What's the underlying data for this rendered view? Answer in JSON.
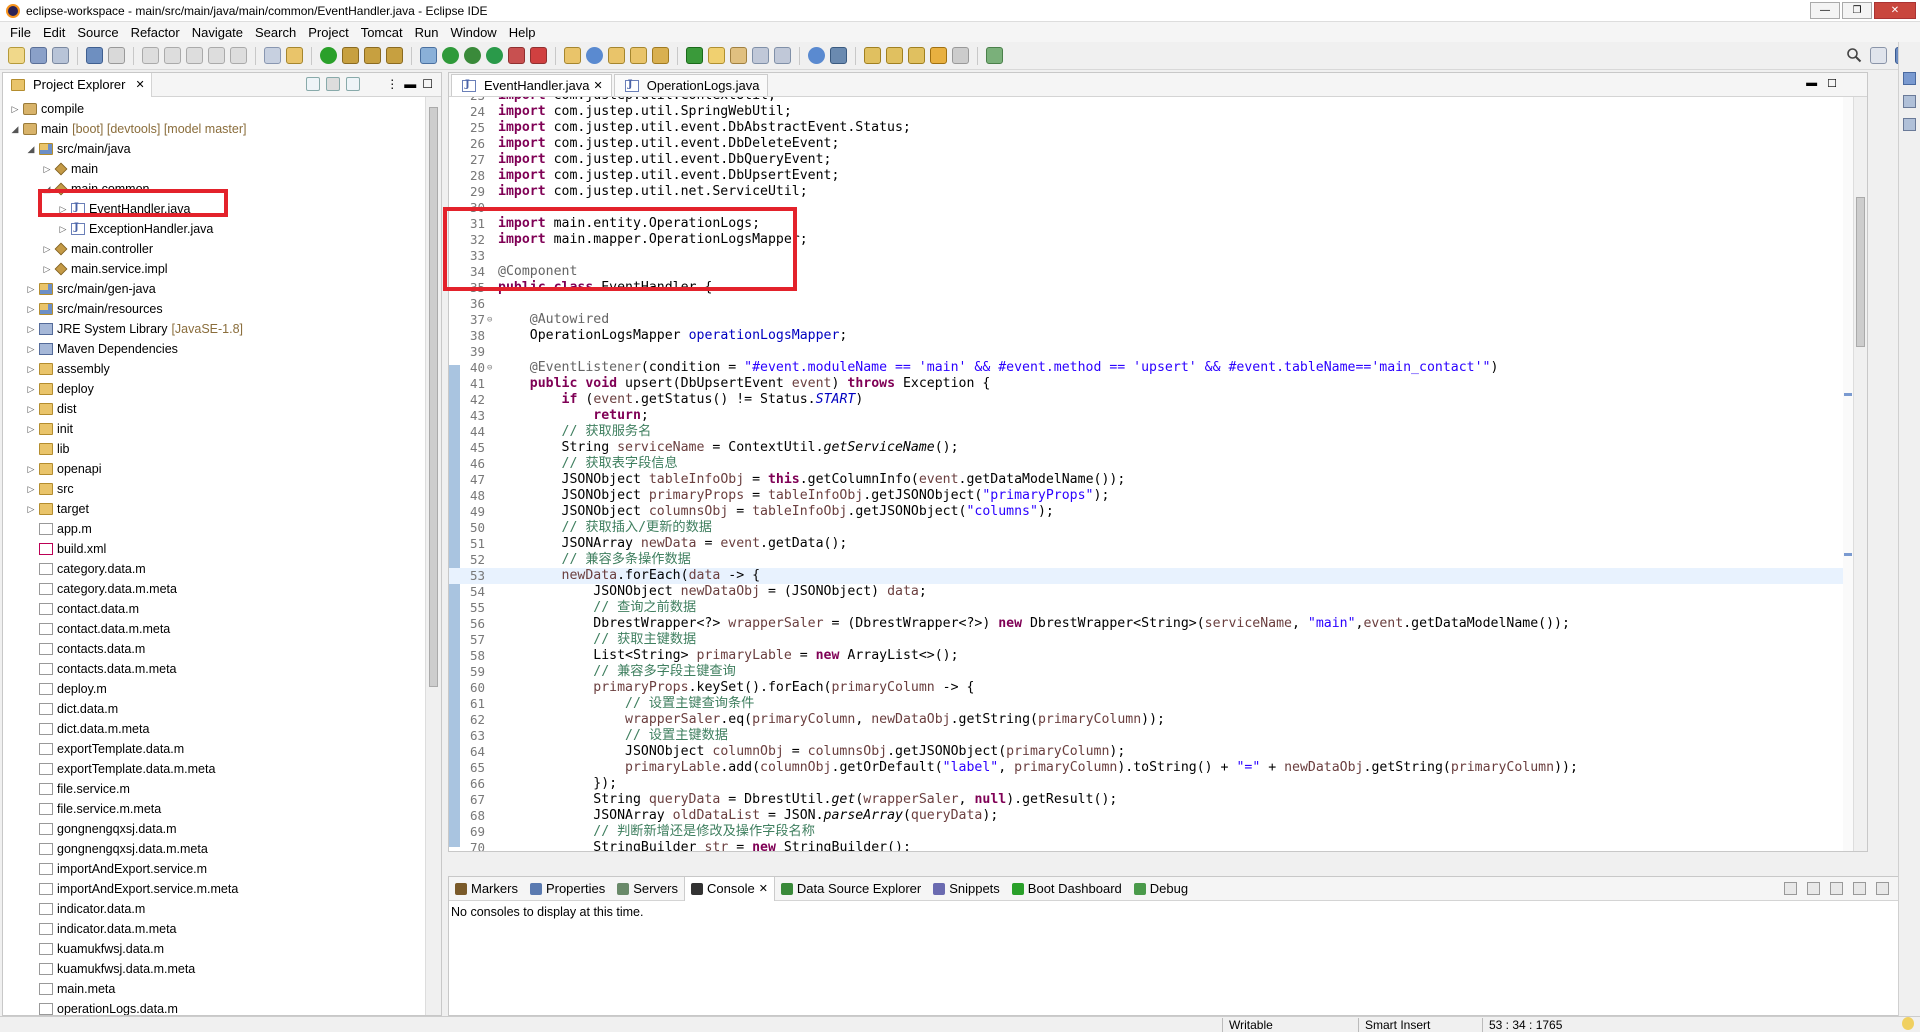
{
  "window": {
    "title": "eclipse-workspace - main/src/main/java/main/common/EventHandler.java - Eclipse IDE",
    "minimize": "—",
    "maximize": "❐",
    "close": "✕"
  },
  "menu": [
    "File",
    "Edit",
    "Source",
    "Refactor",
    "Navigate",
    "Search",
    "Project",
    "Tomcat",
    "Run",
    "Window",
    "Help"
  ],
  "explorer": {
    "title": "Project Explorer",
    "items": [
      {
        "label": "compile",
        "indent": 0,
        "twisty": "▷",
        "icon": "proj"
      },
      {
        "label": "main",
        "deco": "[boot] [devtools] [model master]",
        "indent": 0,
        "twisty": "◢",
        "icon": "proj"
      },
      {
        "label": "src/main/java",
        "indent": 1,
        "twisty": "◢",
        "icon": "src"
      },
      {
        "label": "main",
        "indent": 2,
        "twisty": "▷",
        "icon": "pkg"
      },
      {
        "label": "main.common",
        "indent": 2,
        "twisty": "◢",
        "icon": "pkg"
      },
      {
        "label": "EventHandler.java",
        "indent": 3,
        "twisty": "▷",
        "icon": "java"
      },
      {
        "label": "ExceptionHandler.java",
        "indent": 3,
        "twisty": "▷",
        "icon": "java"
      },
      {
        "label": "main.controller",
        "indent": 2,
        "twisty": "▷",
        "icon": "pkg"
      },
      {
        "label": "main.service.impl",
        "indent": 2,
        "twisty": "▷",
        "icon": "pkg"
      },
      {
        "label": "src/main/gen-java",
        "indent": 1,
        "twisty": "▷",
        "icon": "src"
      },
      {
        "label": "src/main/resources",
        "indent": 1,
        "twisty": "▷",
        "icon": "src"
      },
      {
        "label": "JRE System Library",
        "deco": "[JavaSE-1.8]",
        "indent": 1,
        "twisty": "▷",
        "icon": "lib"
      },
      {
        "label": "Maven Dependencies",
        "indent": 1,
        "twisty": "▷",
        "icon": "lib"
      },
      {
        "label": "assembly",
        "indent": 1,
        "twisty": "▷",
        "icon": "folder"
      },
      {
        "label": "deploy",
        "indent": 1,
        "twisty": "▷",
        "icon": "folder"
      },
      {
        "label": "dist",
        "indent": 1,
        "twisty": "▷",
        "icon": "folder"
      },
      {
        "label": "init",
        "indent": 1,
        "twisty": "▷",
        "icon": "folder"
      },
      {
        "label": "lib",
        "indent": 1,
        "twisty": "",
        "icon": "folder"
      },
      {
        "label": "openapi",
        "indent": 1,
        "twisty": "▷",
        "icon": "folder"
      },
      {
        "label": "src",
        "indent": 1,
        "twisty": "▷",
        "icon": "folder"
      },
      {
        "label": "target",
        "indent": 1,
        "twisty": "▷",
        "icon": "folder"
      },
      {
        "label": "app.m",
        "indent": 1,
        "twisty": "",
        "icon": "file"
      },
      {
        "label": "build.xml",
        "indent": 1,
        "twisty": "",
        "icon": "xml"
      },
      {
        "label": "category.data.m",
        "indent": 1,
        "twisty": "",
        "icon": "file"
      },
      {
        "label": "category.data.m.meta",
        "indent": 1,
        "twisty": "",
        "icon": "file"
      },
      {
        "label": "contact.data.m",
        "indent": 1,
        "twisty": "",
        "icon": "file"
      },
      {
        "label": "contact.data.m.meta",
        "indent": 1,
        "twisty": "",
        "icon": "file"
      },
      {
        "label": "contacts.data.m",
        "indent": 1,
        "twisty": "",
        "icon": "file"
      },
      {
        "label": "contacts.data.m.meta",
        "indent": 1,
        "twisty": "",
        "icon": "file"
      },
      {
        "label": "deploy.m",
        "indent": 1,
        "twisty": "",
        "icon": "file"
      },
      {
        "label": "dict.data.m",
        "indent": 1,
        "twisty": "",
        "icon": "file"
      },
      {
        "label": "dict.data.m.meta",
        "indent": 1,
        "twisty": "",
        "icon": "file"
      },
      {
        "label": "exportTemplate.data.m",
        "indent": 1,
        "twisty": "",
        "icon": "file"
      },
      {
        "label": "exportTemplate.data.m.meta",
        "indent": 1,
        "twisty": "",
        "icon": "file"
      },
      {
        "label": "file.service.m",
        "indent": 1,
        "twisty": "",
        "icon": "file"
      },
      {
        "label": "file.service.m.meta",
        "indent": 1,
        "twisty": "",
        "icon": "file"
      },
      {
        "label": "gongnengqxsj.data.m",
        "indent": 1,
        "twisty": "",
        "icon": "file"
      },
      {
        "label": "gongnengqxsj.data.m.meta",
        "indent": 1,
        "twisty": "",
        "icon": "file"
      },
      {
        "label": "importAndExport.service.m",
        "indent": 1,
        "twisty": "",
        "icon": "file"
      },
      {
        "label": "importAndExport.service.m.meta",
        "indent": 1,
        "twisty": "",
        "icon": "file"
      },
      {
        "label": "indicator.data.m",
        "indent": 1,
        "twisty": "",
        "icon": "file"
      },
      {
        "label": "indicator.data.m.meta",
        "indent": 1,
        "twisty": "",
        "icon": "file"
      },
      {
        "label": "kuamukfwsj.data.m",
        "indent": 1,
        "twisty": "",
        "icon": "file"
      },
      {
        "label": "kuamukfwsj.data.m.meta",
        "indent": 1,
        "twisty": "",
        "icon": "file"
      },
      {
        "label": "main.meta",
        "indent": 1,
        "twisty": "",
        "icon": "file"
      },
      {
        "label": "operationLogs.data.m",
        "indent": 1,
        "twisty": "",
        "icon": "file"
      }
    ]
  },
  "editor": {
    "tabs": [
      {
        "label": "EventHandler.java",
        "active": true,
        "closable": "✕"
      },
      {
        "label": "OperationLogs.java",
        "active": false
      }
    ],
    "lines": [
      {
        "n": "23",
        "html": "<span class=\"kw\">import</span> com.justep.util.ContextUtil;"
      },
      {
        "n": "24",
        "html": "<span class=\"kw\">import</span> com.justep.util.SpringWebUtil;"
      },
      {
        "n": "25",
        "html": "<span class=\"kw\">import</span> com.justep.util.event.DbAbstractEvent.Status;"
      },
      {
        "n": "26",
        "html": "<span class=\"kw\">import</span> com.justep.util.event.DbDeleteEvent;"
      },
      {
        "n": "27",
        "html": "<span class=\"kw\">import</span> com.justep.util.event.DbQueryEvent;"
      },
      {
        "n": "28",
        "html": "<span class=\"kw\">import</span> com.justep.util.event.DbUpsertEvent;"
      },
      {
        "n": "29",
        "html": "<span class=\"kw\">import</span> com.justep.util.net.ServiceUtil;"
      },
      {
        "n": "30",
        "html": ""
      },
      {
        "n": "31",
        "html": "<span class=\"kw\">import</span> main.entity.OperationLogs;"
      },
      {
        "n": "32",
        "html": "<span class=\"kw\">import</span> main.mapper.OperationLogsMapper;"
      },
      {
        "n": "33",
        "html": ""
      },
      {
        "n": "34",
        "html": "<span class=\"ann\">@Component</span>"
      },
      {
        "n": "35",
        "html": "<span class=\"kw\">public class</span> EventHandler {"
      },
      {
        "n": "36",
        "html": ""
      },
      {
        "n": "37",
        "fold": "⊖",
        "html": "    <span class=\"ann\">@Autowired</span>"
      },
      {
        "n": "38",
        "html": "    OperationLogsMapper <span class=\"fld\">operationLogsMapper</span>;"
      },
      {
        "n": "39",
        "html": ""
      },
      {
        "n": "40",
        "fold": "⊖",
        "html": "    <span class=\"ann\">@EventListener</span>(condition = <span class=\"str\">\"#event.moduleName == 'main' &amp;&amp; #event.method == 'upsert' &amp;&amp; #event.tableName=='main_contact'\"</span>)"
      },
      {
        "n": "41",
        "html": "    <span class=\"kw\">public void</span> upsert(DbUpsertEvent <span class=\"var\">event</span>) <span class=\"kw\">throws</span> Exception {"
      },
      {
        "n": "42",
        "html": "        <span class=\"kw\">if</span> (<span class=\"var\">event</span>.getStatus() != Status.<span class=\"fld it\">START</span>)"
      },
      {
        "n": "43",
        "html": "            <span class=\"kw\">return</span>;"
      },
      {
        "n": "44",
        "html": "        <span class=\"cmt\">// 获取服务名</span>"
      },
      {
        "n": "45",
        "html": "        String <span class=\"var\">serviceName</span> = ContextUtil.<span class=\"it\">getServiceName</span>();"
      },
      {
        "n": "46",
        "html": "        <span class=\"cmt\">// 获取表字段信息</span>"
      },
      {
        "n": "47",
        "html": "        JSONObject <span class=\"var\">tableInfoObj</span> = <span class=\"kw\">this</span>.getColumnInfo(<span class=\"var\">event</span>.getDataModelName());"
      },
      {
        "n": "48",
        "html": "        JSONObject <span class=\"var\">primaryProps</span> = <span class=\"var\">tableInfoObj</span>.getJSONObject(<span class=\"str\">\"primaryProps\"</span>);"
      },
      {
        "n": "49",
        "html": "        JSONObject <span class=\"var\">columnsObj</span> = <span class=\"var\">tableInfoObj</span>.getJSONObject(<span class=\"str\">\"columns\"</span>);"
      },
      {
        "n": "50",
        "html": "        <span class=\"cmt\">// 获取插入/更新的数据</span>"
      },
      {
        "n": "51",
        "html": "        JSONArray <span class=\"var\">newData</span> = <span class=\"var\">event</span>.getData();"
      },
      {
        "n": "52",
        "html": "        <span class=\"cmt\">// 兼容多条操作数据</span>"
      },
      {
        "n": "53",
        "current": true,
        "html": "        <span class=\"var\">newData</span>.forEach(<span class=\"var\">data</span> -> {"
      },
      {
        "n": "54",
        "html": "            JSONObject <span class=\"var\">newDataObj</span> = (JSONObject) <span class=\"var\">data</span>;"
      },
      {
        "n": "55",
        "html": "            <span class=\"cmt\">// 查询之前数据</span>"
      },
      {
        "n": "56",
        "html": "            DbrestWrapper&lt;?&gt; <span class=\"var\">wrapperSaler</span> = (DbrestWrapper&lt;?&gt;) <span class=\"kw\">new</span> DbrestWrapper&lt;String&gt;(<span class=\"var\">serviceName</span>, <span class=\"str\">\"main\"</span>,<span class=\"var\">event</span>.getDataModelName());"
      },
      {
        "n": "57",
        "html": "            <span class=\"cmt\">// 获取主键数据</span>"
      },
      {
        "n": "58",
        "html": "            List&lt;String&gt; <span class=\"var\">primaryLable</span> = <span class=\"kw\">new</span> ArrayList&lt;&gt;();"
      },
      {
        "n": "59",
        "html": "            <span class=\"cmt\">// 兼容多字段主键查询</span>"
      },
      {
        "n": "60",
        "html": "            <span class=\"var\">primaryProps</span>.keySet().forEach(<span class=\"var\">primaryColumn</span> -> {"
      },
      {
        "n": "61",
        "html": "                <span class=\"cmt\">// 设置主键查询条件</span>"
      },
      {
        "n": "62",
        "html": "                <span class=\"var\">wrapperSaler</span>.eq(<span class=\"var\">primaryColumn</span>, <span class=\"var\">newDataObj</span>.getString(<span class=\"var\">primaryColumn</span>));"
      },
      {
        "n": "63",
        "html": "                <span class=\"cmt\">// 设置主键数据</span>"
      },
      {
        "n": "64",
        "html": "                JSONObject <span class=\"var\">columnObj</span> = <span class=\"var\">columnsObj</span>.getJSONObject(<span class=\"var\">primaryColumn</span>);"
      },
      {
        "n": "65",
        "html": "                <span class=\"var\">primaryLable</span>.add(<span class=\"var\">columnObj</span>.getOrDefault(<span class=\"str\">\"label\"</span>, <span class=\"var\">primaryColumn</span>).toString() + <span class=\"str\">\"=\"</span> + <span class=\"var\">newDataObj</span>.getString(<span class=\"var\">primaryColumn</span>));"
      },
      {
        "n": "66",
        "html": "            });"
      },
      {
        "n": "67",
        "html": "            String <span class=\"var\">queryData</span> = DbrestUtil.<span class=\"it\">get</span>(<span class=\"var\">wrapperSaler</span>, <span class=\"kw\">null</span>).getResult();"
      },
      {
        "n": "68",
        "html": "            JSONArray <span class=\"var\">oldDataList</span> = JSON.<span class=\"it\">parseArray</span>(<span class=\"var\">queryData</span>);"
      },
      {
        "n": "69",
        "html": "            <span class=\"cmt\">// 判断新增还是修改及操作字段名称</span>"
      },
      {
        "n": "70",
        "html": "            StringBuilder <span class=\"var\">str</span> = <span class=\"kw\">new</span> StringBuilder();"
      }
    ]
  },
  "console": {
    "tabs": [
      {
        "label": "Markers",
        "color": "#7a5a2a"
      },
      {
        "label": "Properties",
        "color": "#5a7ab0"
      },
      {
        "label": "Servers",
        "color": "#6a8a6a"
      },
      {
        "label": "Console",
        "color": "#333",
        "active": true,
        "closable": "✕"
      },
      {
        "label": "Data Source Explorer",
        "color": "#3a8a3a"
      },
      {
        "label": "Snippets",
        "color": "#6a6ab0"
      },
      {
        "label": "Boot Dashboard",
        "color": "#2aa02a"
      },
      {
        "label": "Debug",
        "color": "#4a9a4a"
      }
    ],
    "message": "No consoles to display at this time."
  },
  "status": {
    "writable": "Writable",
    "insert_mode": "Smart Insert",
    "position": "53 : 34 : 1765"
  }
}
